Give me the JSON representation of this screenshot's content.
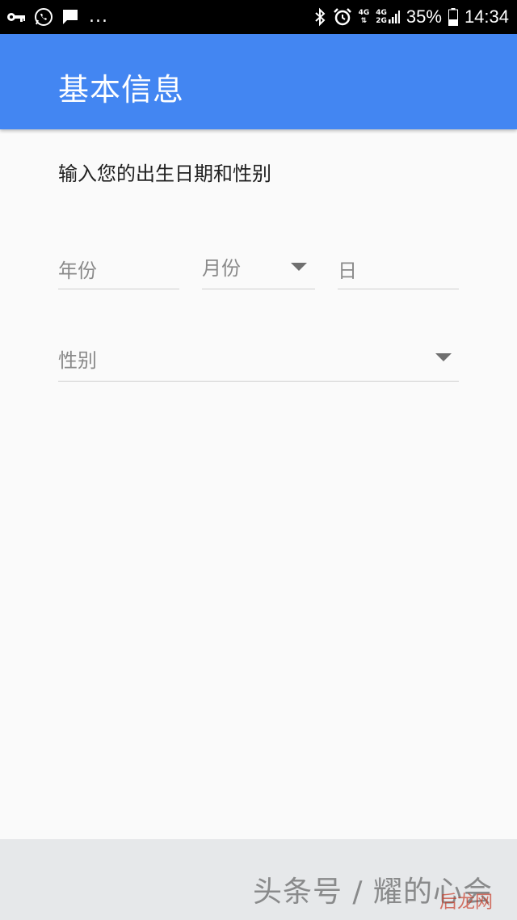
{
  "status_bar": {
    "left_icons": [
      "key-icon",
      "whatsapp-icon",
      "message-icon"
    ],
    "more_dots": "...",
    "right_icons": [
      "bluetooth-icon",
      "alarm-icon"
    ],
    "network_1": {
      "top": "4G",
      "bottom": "⇅"
    },
    "network_2": {
      "top": "4G",
      "bottom": "2G"
    },
    "battery_percent": "35%",
    "time": "14:34"
  },
  "app_bar": {
    "title": "基本信息"
  },
  "form": {
    "prompt": "输入您的出生日期和性别",
    "year_placeholder": "年份",
    "month_placeholder": "月份",
    "day_placeholder": "日",
    "gender_placeholder": "性别"
  },
  "watermark": {
    "text": "头条号 / 耀的心会",
    "overlay": "后龙网"
  },
  "colors": {
    "app_bar": "#4386f2",
    "background": "#fafafa",
    "bottom_bar": "#e6e8ea"
  }
}
